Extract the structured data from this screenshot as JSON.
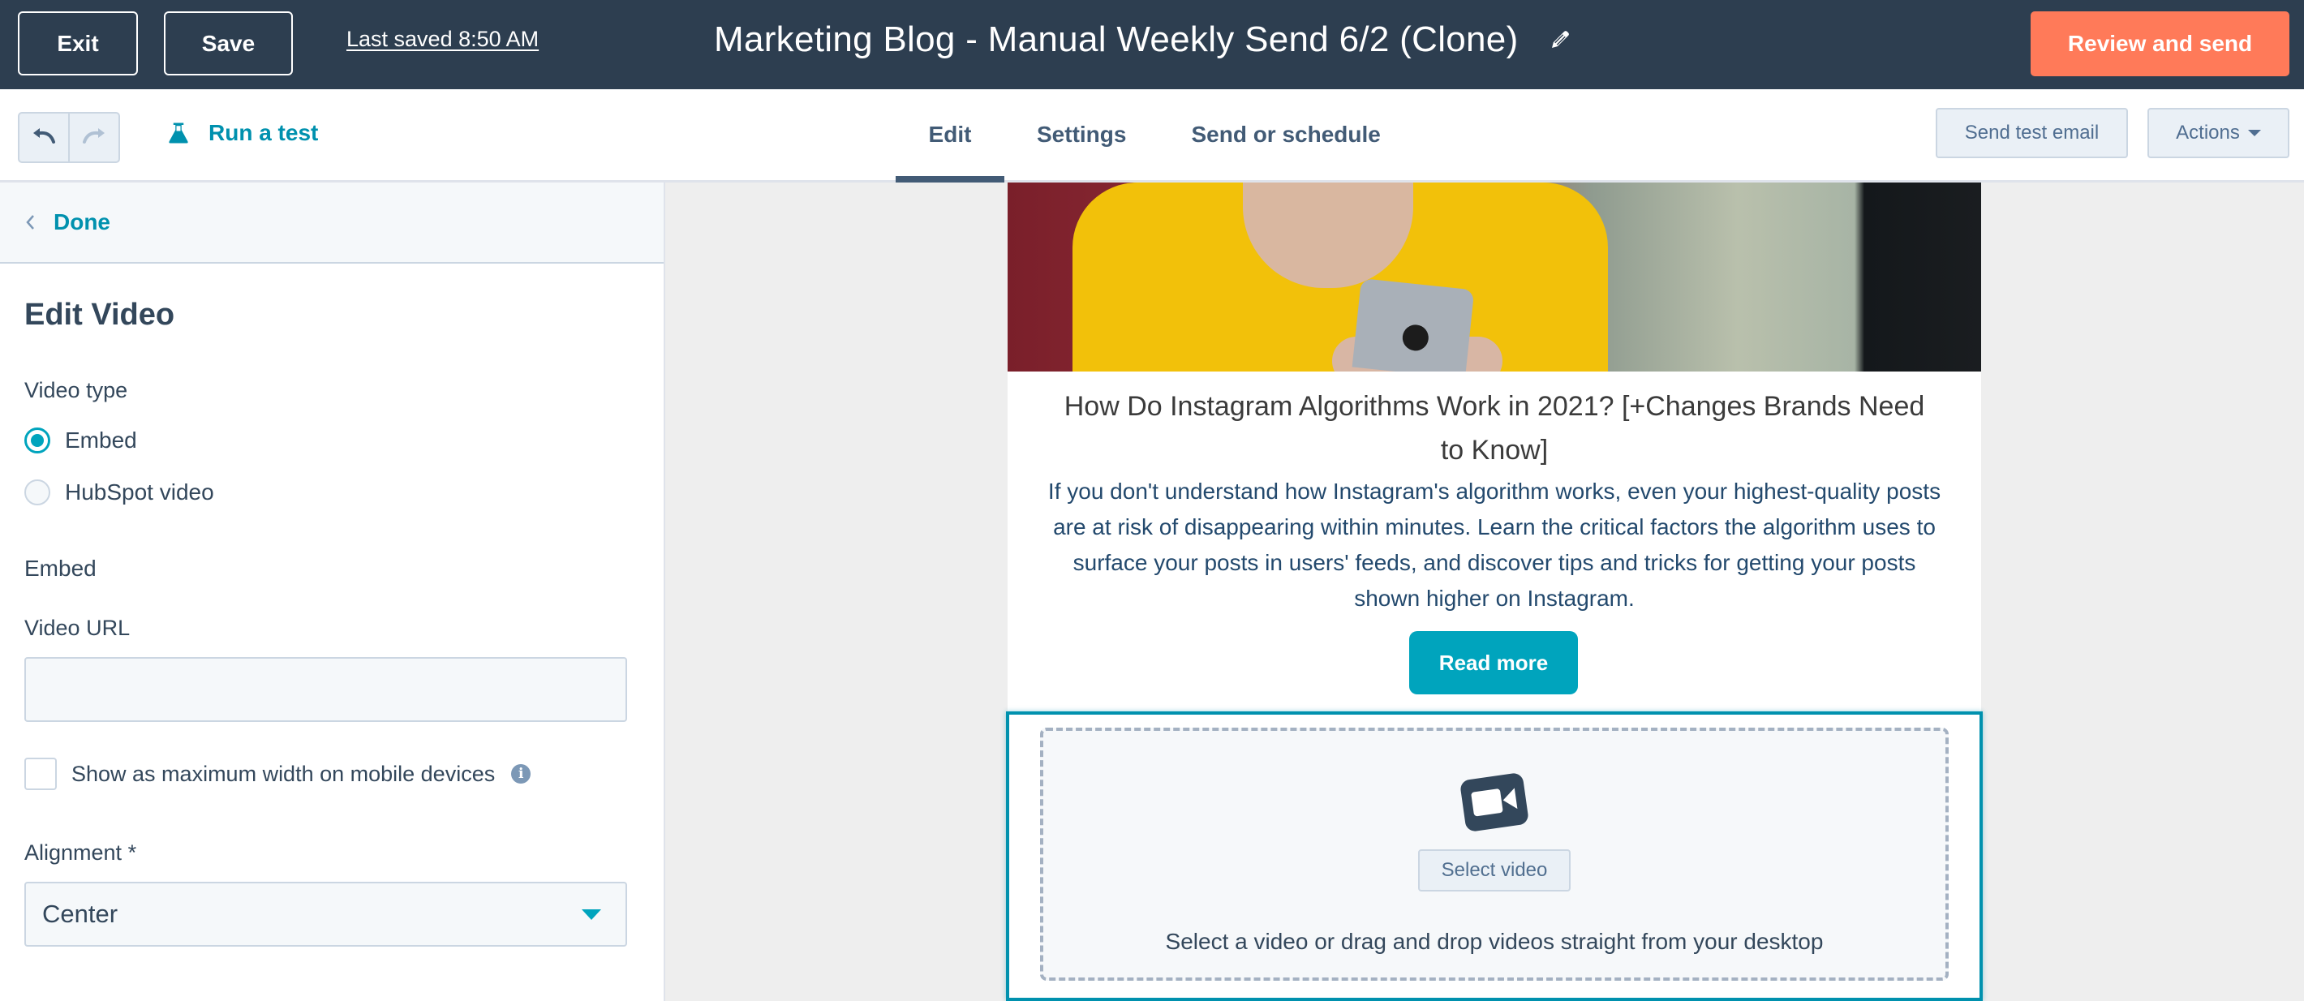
{
  "topbar": {
    "exit_label": "Exit",
    "save_label": "Save",
    "last_saved": "Last saved 8:50 AM",
    "title": "Marketing Blog - Manual Weekly Send 6/2 (Clone)",
    "edit_title_icon": "pencil-icon",
    "review_label": "Review and send"
  },
  "subbar": {
    "undo_icon": "undo-icon",
    "redo_icon": "redo-icon",
    "run_test_label": "Run a test",
    "tabs": [
      {
        "label": "Edit",
        "active": true
      },
      {
        "label": "Settings",
        "active": false
      },
      {
        "label": "Send or schedule",
        "active": false
      }
    ],
    "send_test_label": "Send test email",
    "actions_label": "Actions"
  },
  "panel": {
    "done_label": "Done",
    "title": "Edit Video",
    "video_type_label": "Video type",
    "video_type_options": [
      {
        "label": "Embed",
        "checked": true
      },
      {
        "label": "HubSpot video",
        "checked": false
      }
    ],
    "embed_section_label": "Embed",
    "video_url_label": "Video URL",
    "video_url_value": "",
    "max_width_label": "Show as maximum width on mobile devices",
    "max_width_checked": false,
    "info_glyph": "i",
    "alignment_label": "Alignment *",
    "alignment_value": "Center"
  },
  "email": {
    "post_title": "How Do Instagram Algorithms Work in 2021? [+Changes Brands Need to Know]",
    "post_body": "If you don't understand how Instagram's algorithm works, even your highest-quality posts are at risk of disappearing within minutes. Learn the critical factors the algorithm uses to surface your posts in users' feeds, and discover tips and tricks for getting your posts shown higher on Instagram.",
    "read_more_label": "Read more",
    "video": {
      "icon": "video-camera-icon",
      "select_label": "Select video",
      "drop_text": "Select a video or drag and drop videos straight from your desktop"
    }
  },
  "colors": {
    "topbar_bg": "#2d3e50",
    "accent_orange": "#ff7a59",
    "accent_teal": "#00a4bd",
    "link_teal": "#0091ae",
    "canvas_bg": "#eeeeee"
  }
}
